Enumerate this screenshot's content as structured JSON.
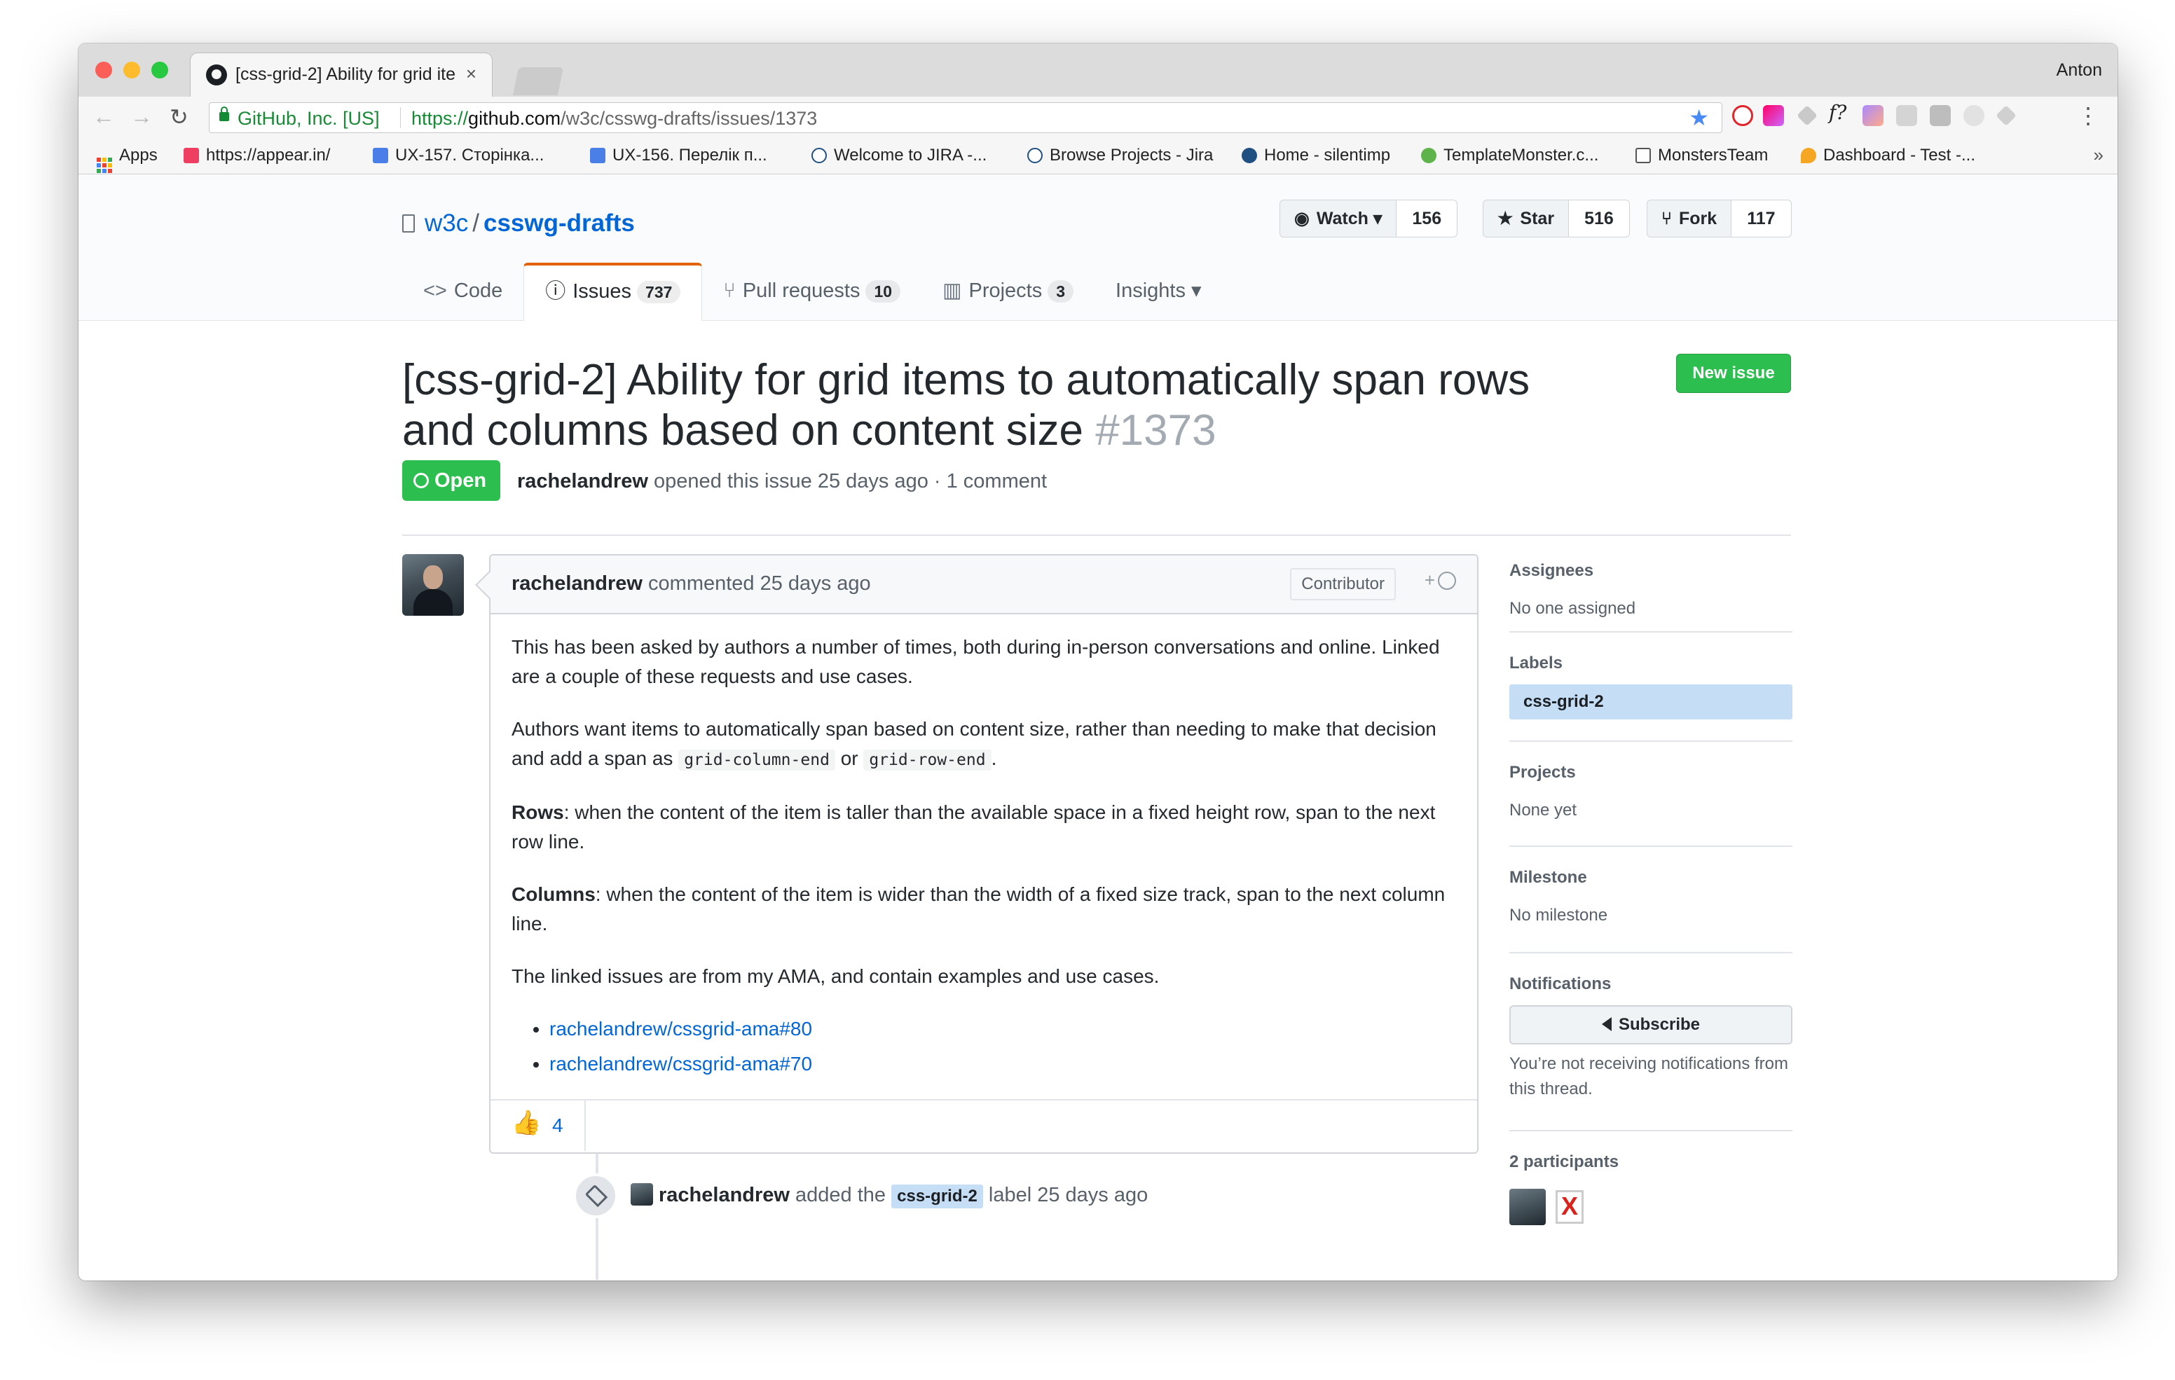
{
  "browser": {
    "tab_title": "[css-grid-2] Ability for grid ite",
    "tab_close": "×",
    "user": "Anton",
    "secure_label": "GitHub, Inc. [US]",
    "url_scheme": "https://",
    "url_host": "github.com",
    "url_path": "/w3c/csswg-drafts/issues/1373",
    "back_glyph": "←",
    "forward_glyph": "→",
    "reload_glyph": "↻",
    "star_glyph": "★",
    "menu_glyph": "⋮",
    "extension_icons": [
      "opera-icon",
      "gradient-icon",
      "dropbox-icon",
      "fquery-icon",
      "purple-extension-icon",
      "cast-icon",
      "grid-extension-icon",
      "circle-extension-icon",
      "diamond-extension-icon"
    ],
    "colors": {
      "secure": "#158a34",
      "star": "#4a8af4"
    }
  },
  "bookmarks": {
    "items": [
      {
        "label": "Apps",
        "icon": "apps-grid-icon"
      },
      {
        "label": "https://appear.in/",
        "icon": "appear-in-icon"
      },
      {
        "label": "UX-157. Сторінка...",
        "icon": "google-doc-icon"
      },
      {
        "label": "UX-156. Перелік п...",
        "icon": "google-doc-icon"
      },
      {
        "label": "Welcome to JIRA -...",
        "icon": "jira-icon"
      },
      {
        "label": "Browse Projects - Jira",
        "icon": "jira-icon"
      },
      {
        "label": "Home - silentimp",
        "icon": "confluence-icon"
      },
      {
        "label": "TemplateMonster.c...",
        "icon": "templatemonster-icon"
      },
      {
        "label": "MonstersTeam",
        "icon": "monsters-team-icon"
      },
      {
        "label": "Dashboard - Test -...",
        "icon": "dashboard-icon"
      }
    ],
    "more": "»"
  },
  "repo": {
    "owner": "w3c",
    "separator": "/",
    "name": "csswg-drafts",
    "watch": {
      "label": "Watch ▾",
      "count": "156"
    },
    "star": {
      "label": "Star",
      "count": "516"
    },
    "fork": {
      "label": "Fork",
      "count": "117"
    },
    "nav": [
      {
        "label": "Code",
        "icon": "code-icon",
        "count": ""
      },
      {
        "label": "Issues",
        "icon": "issue-opened-icon",
        "count": "737"
      },
      {
        "label": "Pull requests",
        "icon": "pull-request-icon",
        "count": "10"
      },
      {
        "label": "Projects",
        "icon": "project-icon",
        "count": "3"
      },
      {
        "label": "Insights ▾",
        "icon": "",
        "count": ""
      }
    ],
    "active_tab": "Issues",
    "colors": {
      "active_tab_border": "#e36209",
      "link": "#0366d6"
    }
  },
  "issue": {
    "title": "[css-grid-2] Ability for grid items to automatically span rows and columns based on content size",
    "number": "#1373",
    "new_issue_label": "New issue",
    "state": "Open",
    "author": "rachelandrew",
    "meta": "opened this issue 25 days ago · 1 comment",
    "colors": {
      "open": "#2cbe4e",
      "new_issue": "#2cbe4e"
    }
  },
  "comment": {
    "author": "rachelandrew",
    "action": "commented 25 days ago",
    "role_badge": "Contributor",
    "reaction_add": "+",
    "body": {
      "p1": "This has been asked by authors a number of times, both during in-person conversations and online. Linked are a couple of these requests and use cases.",
      "p2_before": "Authors want items to automatically span based on content size, rather than needing to make that decision and add a span as",
      "code1": "grid-column-end",
      "p2_or": "or",
      "code2": "grid-row-end",
      "p2_after": ".",
      "rows_label": "Rows",
      "rows_text": ": when the content of the item is taller than the available space in a fixed height row, span to the next row line.",
      "columns_label": "Columns",
      "columns_text": ": when the content of the item is wider than the width of a fixed size track, span to the next column line.",
      "p5": "The linked issues are from my AMA, and contain examples and use cases.",
      "links": [
        "rachelandrew/cssgrid-ama#80",
        "rachelandrew/cssgrid-ama#70"
      ]
    },
    "reactions": {
      "emoji": "👍",
      "count": "4"
    }
  },
  "timeline_event": {
    "actor": "rachelandrew",
    "text_before": "added the",
    "label": "css-grid-2",
    "text_after": "label 25 days ago",
    "label_color": "#c5def5"
  },
  "sidebar": {
    "assignees": {
      "title": "Assignees",
      "value": "No one assigned"
    },
    "labels": {
      "title": "Labels",
      "value": "css-grid-2"
    },
    "projects": {
      "title": "Projects",
      "value": "None yet"
    },
    "milestone": {
      "title": "Milestone",
      "value": "No milestone"
    },
    "notifications": {
      "title": "Notifications",
      "button": "Subscribe",
      "note": "You’re not receiving notifications from this thread."
    },
    "participants": {
      "title": "2 participants"
    }
  }
}
